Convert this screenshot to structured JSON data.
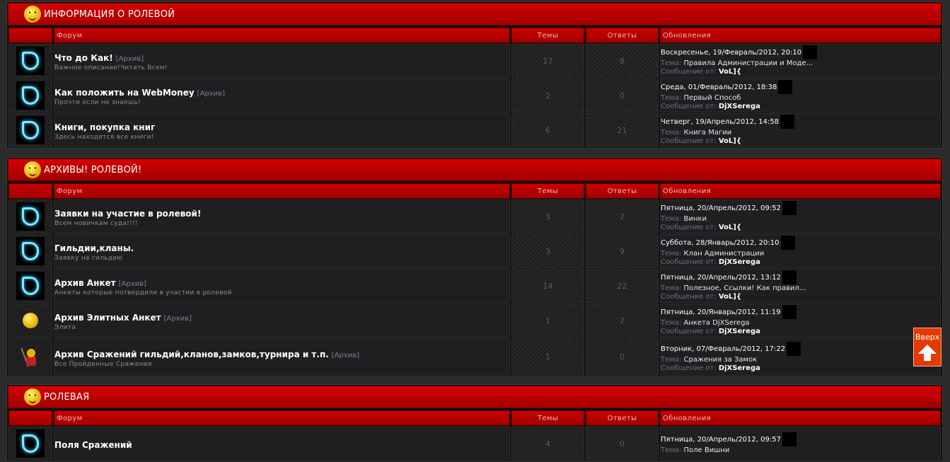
{
  "labels": {
    "forum": "Форум",
    "topics": "Темы",
    "replies": "Ответы",
    "updates": "Обновления",
    "topic_prefix": "Тема:",
    "msg_prefix": "Сообщение от:"
  },
  "categories": [
    {
      "title": "ИНФОРМАЦИЯ О РОЛЕВОЙ",
      "forums": [
        {
          "icon": "forum-icon",
          "name": "Что до Как!",
          "archive": "[Архив]",
          "desc": "Важное описание!Читать Всем!",
          "topics": "17",
          "replies": "8",
          "date": "Воскресенье, 19/Февраль/2012, 20:10",
          "topic": "Правила Администрации и Моде...",
          "user": "VoL]{"
        },
        {
          "icon": "forum-icon",
          "name": "Как положить на WebMoney",
          "archive": "[Архив]",
          "desc": "Прочти если не знаешь!",
          "topics": "2",
          "replies": "0",
          "date": "Среда, 01/Февраль/2012, 18:38",
          "topic": "Первый Способ",
          "user": "DjXSerega"
        },
        {
          "icon": "forum-icon",
          "name": "Книги, покупка книг",
          "archive": "",
          "desc": "Здесь находятся все книги!",
          "topics": "6",
          "replies": "21",
          "date": "Четверг, 19/Апрель/2012, 14:58",
          "topic": "Книга Магии",
          "user": "VoL]{"
        }
      ]
    },
    {
      "title": "АРХИВЫ! РОЛЕВОЙ!",
      "forums": [
        {
          "icon": "forum-icon",
          "name": "Заявки на участие в ролевой!",
          "archive": "",
          "desc": "Всем новичкам суда!!!!",
          "topics": "3",
          "replies": "2",
          "date": "Пятница, 20/Апрель/2012, 09:52",
          "topic": "Винки",
          "user": "VoL]{"
        },
        {
          "icon": "forum-icon",
          "name": "Гильдии,кланы.",
          "archive": "",
          "desc": "Заявку на гильдию",
          "topics": "3",
          "replies": "9",
          "date": "Суббота, 28/Январь/2012, 20:10",
          "topic": "Клан Администрации",
          "user": "DjXSerega"
        },
        {
          "icon": "forum-icon",
          "name": "Архив Анкет",
          "archive": "[Архив]",
          "desc": "Анкеты которые потвердили в участии в ролевой",
          "topics": "14",
          "replies": "22",
          "date": "Пятница, 20/Апрель/2012, 13:12",
          "topic": "Полезное, Ссылки! Как правил...",
          "user": "VoL]{"
        },
        {
          "icon": "hat-smiley-icon",
          "name": "Архив Элитных Анкет",
          "archive": "[Архив]",
          "desc": "Элита",
          "topics": "1",
          "replies": "2",
          "date": "Пятница, 20/Январь/2012, 11:19",
          "topic": "Анкета DjXSerega",
          "user": "DjXSerega"
        },
        {
          "icon": "knight-icon",
          "name": "Архив Сражений гильдий,кланов,замков,турнира и т.п.",
          "archive": "[Архив]",
          "desc": "Все Пройденные Сражения",
          "topics": "1",
          "replies": "0",
          "date": "Вторник, 07/Февраль/2012, 17:22",
          "topic": "Сражения за Замок",
          "user": "DjXSerega"
        }
      ]
    },
    {
      "title": "РОЛЕВАЯ",
      "forums": [
        {
          "icon": "forum-icon",
          "name": "Поля Сражений",
          "archive": "",
          "desc": "",
          "topics": "4",
          "replies": "0",
          "date": "Пятница, 20/Апрель/2012, 09:57",
          "topic": "Поле Вишни",
          "user": ""
        }
      ]
    }
  ],
  "top_button": {
    "label": "Вверх"
  }
}
